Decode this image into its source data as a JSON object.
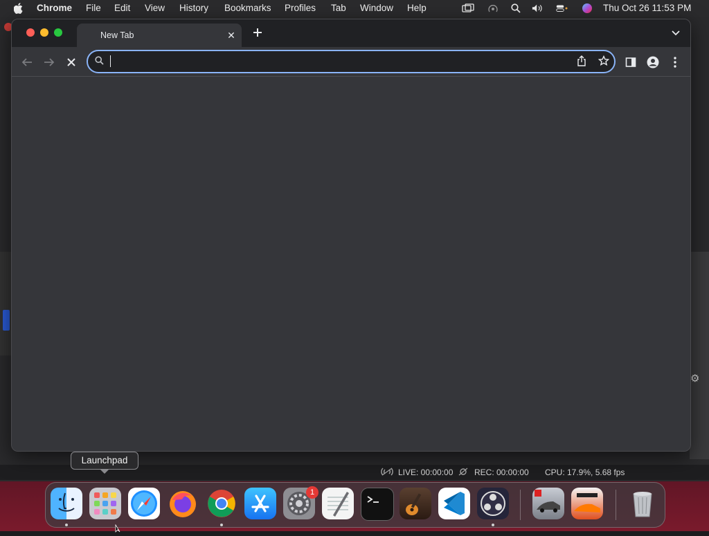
{
  "menubar": {
    "app_name": "Chrome",
    "items": [
      "File",
      "Edit",
      "View",
      "History",
      "Bookmarks",
      "Profiles",
      "Tab",
      "Window",
      "Help"
    ],
    "datetime": "Thu Oct 26  11:53 PM"
  },
  "browser": {
    "tab_title": "New Tab",
    "omnibox_value": "",
    "omnibox_placeholder": ""
  },
  "tooltip": {
    "text": "Launchpad"
  },
  "status_bar": {
    "live": "LIVE: 00:00:00",
    "rec": "REC: 00:00:00",
    "cpu": "CPU: 17.9%, 5.68 fps"
  },
  "dock": {
    "apps": [
      "Finder",
      "Launchpad",
      "Safari",
      "Firefox",
      "Google Chrome",
      "App Store",
      "System Settings",
      "TextEdit",
      "Terminal",
      "GarageBand",
      "Visual Studio Code",
      "OBS",
      "Asphalt 8",
      "Asphalt 9",
      "Trash"
    ],
    "settings_badge": "1"
  },
  "colors": {
    "accent": "#8ab4f8",
    "toolbar": "#35363a",
    "tabstrip": "#202124"
  }
}
